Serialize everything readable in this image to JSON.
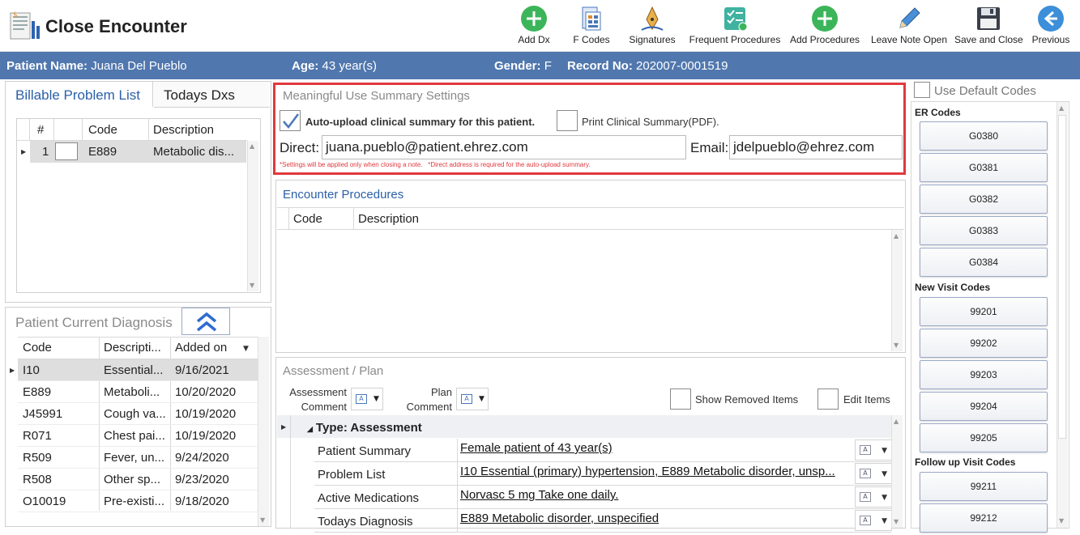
{
  "app": {
    "title": "Close Encounter"
  },
  "toolbar": {
    "add_dx": "Add Dx",
    "f_codes": "F Codes",
    "signatures": "Signatures",
    "frequent_procedures": "Frequent Procedures",
    "add_procedures": "Add Procedures",
    "leave_note_open": "Leave Note Open",
    "save_and_close": "Save and Close",
    "previous": "Previous"
  },
  "patient": {
    "name_label": "Patient Name:",
    "name": "Juana Del Pueblo",
    "age_label": "Age:",
    "age": "43 year(s)",
    "gender_label": "Gender:",
    "gender": "F",
    "record_label": "Record No:",
    "record": "202007-0001519"
  },
  "billable": {
    "tabs": [
      "Billable Problem List",
      "Todays Dxs"
    ],
    "columns": [
      "#",
      "Code",
      "Description"
    ],
    "rows": [
      {
        "num": "1",
        "code": "E889",
        "desc": "Metabolic dis..."
      }
    ]
  },
  "current_dx": {
    "title": "Patient Current Diagnosis",
    "columns": [
      "Code",
      "Descripti...",
      "Added on"
    ],
    "rows": [
      {
        "code": "I10",
        "desc": "Essential...",
        "date": "9/16/2021"
      },
      {
        "code": "E889",
        "desc": "Metaboli...",
        "date": "10/20/2020"
      },
      {
        "code": "J45991",
        "desc": "Cough va...",
        "date": "10/19/2020"
      },
      {
        "code": "R071",
        "desc": "Chest pai...",
        "date": "10/19/2020"
      },
      {
        "code": "R509",
        "desc": "Fever, un...",
        "date": "9/24/2020"
      },
      {
        "code": "R508",
        "desc": "Other sp...",
        "date": "9/23/2020"
      },
      {
        "code": "O10019",
        "desc": "Pre-existi...",
        "date": "9/18/2020"
      }
    ]
  },
  "mu": {
    "title": "Meaningful Use Summary Settings",
    "auto_upload_label": "Auto-upload clinical summary for this patient.",
    "auto_upload_checked": true,
    "print_label": "Print Clinical Summary(PDF).",
    "direct_label": "Direct:",
    "direct_value": "juana.pueblo@patient.ehrez.com",
    "email_label": "Email:",
    "email_value": "jdelpueblo@ehrez.com",
    "note": "*Settings will be applied only when closing a note.   *Direct address is required for the auto-upload summary."
  },
  "procedures": {
    "title": "Encounter Procedures",
    "columns": [
      "Code",
      "Description"
    ]
  },
  "assessment": {
    "title": "Assessment / Plan",
    "assessment_comment": "Assessment Comment",
    "plan_comment": "Plan Comment",
    "show_removed": "Show Removed Items",
    "edit_items": "Edit Items",
    "group_label": "Type: Assessment",
    "rows": [
      {
        "label": "Patient Summary",
        "value": "Female patient of 43 year(s)"
      },
      {
        "label": "Problem List",
        "value": "I10 Essential (primary) hypertension, E889 Metabolic disorder, unsp..."
      },
      {
        "label": "Active Medications",
        "value": "Norvasc 5 mg Take one daily. "
      },
      {
        "label": "Todays Diagnosis",
        "value": " E889 Metabolic disorder, unspecified"
      }
    ]
  },
  "codes": {
    "use_default": "Use Default Codes",
    "er_label": "ER Codes",
    "er": [
      "G0380",
      "G0381",
      "G0382",
      "G0383",
      "G0384"
    ],
    "new_label": "New Visit Codes",
    "new": [
      "99201",
      "99202",
      "99203",
      "99204",
      "99205"
    ],
    "follow_label": "Follow up Visit Codes",
    "follow": [
      "99211",
      "99212"
    ]
  },
  "colors": {
    "patient_bar": "#5077ae",
    "highlight_border": "#e0393e",
    "accent_green": "#3cb55a"
  }
}
